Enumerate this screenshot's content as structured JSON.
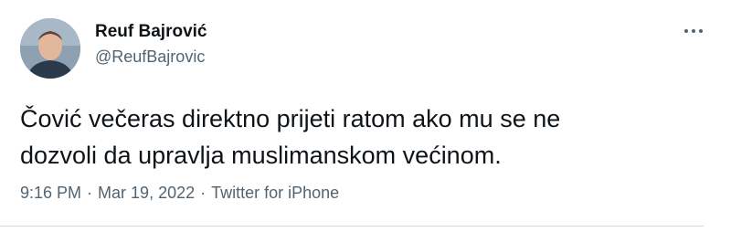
{
  "author": {
    "name": "Reuf Bajrović",
    "handle": "@ReufBajrovic",
    "avatar_icon": "profile-photo"
  },
  "tweet": {
    "lines": [
      "Čović večeras direktno prijeti ratom ako mu se ne",
      "dozvoli da upravlja muslimanskom većinom."
    ]
  },
  "meta": {
    "time": "9:16 PM",
    "date": "Mar 19, 2022",
    "source": "Twitter for iPhone",
    "separator": "·"
  },
  "menu": {
    "icon": "more-horizontal-icon"
  },
  "colors": {
    "text": "#0f1419",
    "secondary": "#536471",
    "divider": "#cfd9de"
  }
}
